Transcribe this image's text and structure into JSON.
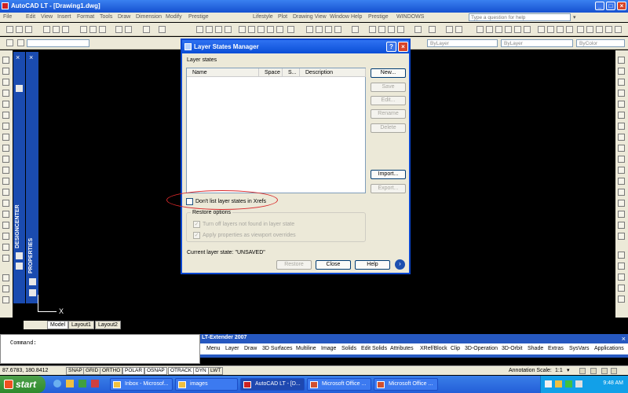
{
  "app": {
    "title": "AutoCAD LT - [Drawing1.dwg]",
    "help_placeholder": "Type a question for help",
    "colors": {
      "title_bar": "#1550d0",
      "canvas": "#000000",
      "toolbar": "#ece9d8",
      "highlight_oval": "#d8282a"
    }
  },
  "menu": [
    "File",
    "Edit",
    "View",
    "Insert",
    "Format",
    "Tools",
    "Draw",
    "Dimension",
    "Modify",
    "Prestige",
    "Lifestyle",
    "Plot",
    "Drawing View",
    "Window",
    "Help",
    "Prestige",
    "WINDOWS"
  ],
  "layers": {
    "bylayer1": "ByLayer",
    "bylayer2": "ByLayer",
    "bycolor": "ByColor"
  },
  "palettes": {
    "designcenter": "DESIGNCENTER",
    "properties": "PROPERTIES"
  },
  "axis_label": "X",
  "tabs": [
    "Model",
    "Layout1",
    "Layout2"
  ],
  "command": {
    "prompt": "Command:"
  },
  "extender": {
    "title": "LT-Extender 2007",
    "items": [
      "Menu",
      "Layer",
      "Draw",
      "3D Surfaces",
      "Multiline",
      "Image",
      "Solids",
      "Edit Solids",
      "Attributes",
      "XRef/Block",
      "Clip",
      "3D-Operation",
      "3D-Orbit",
      "Shade",
      "Extras",
      "SysVars",
      "Applications"
    ]
  },
  "status": {
    "coords": "87.6783, 180.8412",
    "toggles": [
      "SNAP",
      "GRID",
      "ORTHO",
      "POLAR",
      "OSNAP",
      "OTRACK",
      "DYN",
      "LWT"
    ],
    "annotation_label": "Annotation Scale:",
    "annotation_value": "1:1"
  },
  "dialog": {
    "title": "Layer States Manager",
    "group_label": "Layer states",
    "columns": [
      "Name",
      "Space",
      "S...",
      "Description"
    ],
    "buttons": {
      "new": "New...",
      "save": "Save",
      "edit": "Edit...",
      "rename": "Rename",
      "delete": "Delete",
      "import": "Import...",
      "export": "Export..."
    },
    "dont_list_xrefs": "Don't list layer states in Xrefs",
    "restore_options": "Restore options",
    "opt_turn_off": "Turn off layers not found in layer state",
    "opt_apply_props": "Apply properties as viewport overrides",
    "current_state": "Current layer state: \"UNSAVED\"",
    "restore_btn": "Restore",
    "close_btn": "Close",
    "help_btn": "Help"
  },
  "taskbar": {
    "start": "start",
    "tasks": [
      "Inbox - Microsof...",
      "images",
      "AutoCAD LT - [D...",
      "Microsoft Office ...",
      "Microsoft Office ..."
    ],
    "clock": "9:48 AM"
  }
}
